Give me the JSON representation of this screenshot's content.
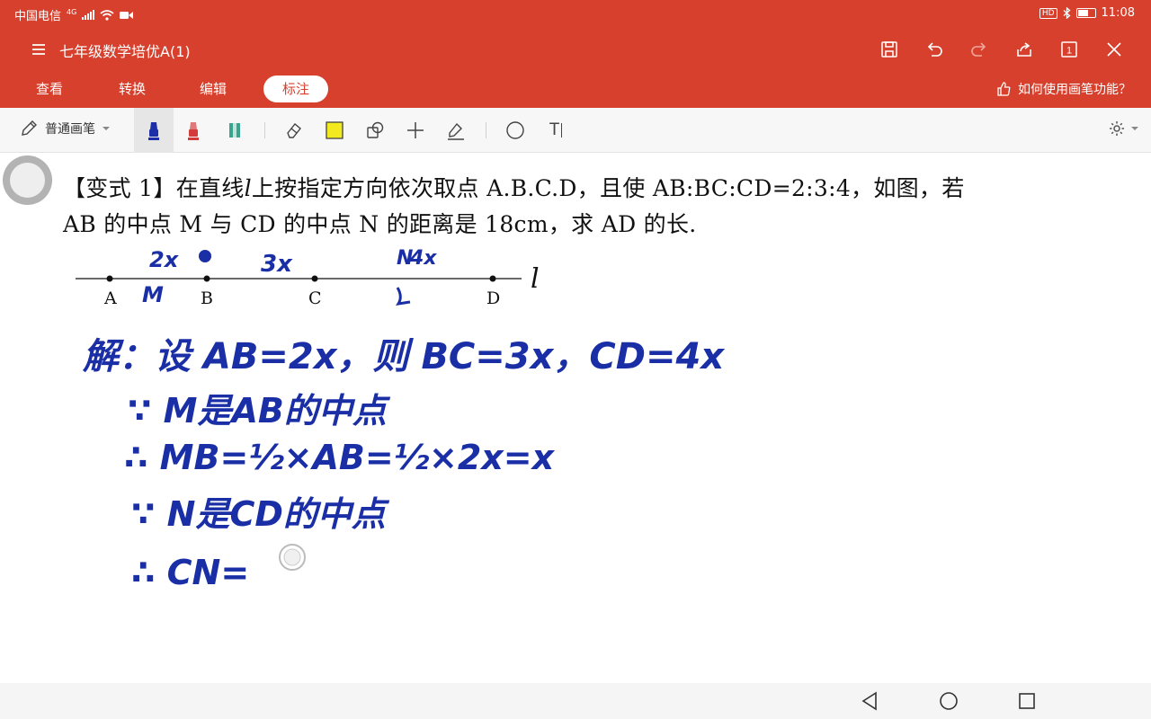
{
  "status": {
    "carrier": "中国电信",
    "network": "4G",
    "time": "11:08",
    "hd_badge": "HD",
    "battery_fraction": 0.55
  },
  "titlebar": {
    "title": "七年级数学培优A(1)",
    "icons": [
      "save-icon",
      "undo-icon",
      "redo-icon",
      "share-icon",
      "page-count-icon",
      "close-icon"
    ],
    "page_count": "1"
  },
  "tabs": {
    "items": [
      {
        "label": "查看",
        "active": false
      },
      {
        "label": "转换",
        "active": false
      },
      {
        "label": "编辑",
        "active": false
      },
      {
        "label": "标注",
        "active": true
      }
    ],
    "help": "如何使用画笔功能？"
  },
  "pen_toolbar": {
    "pen_type": "普通画笔",
    "pen_colors": [
      "#1c2fa8",
      "#d43c3c",
      "#3aa38e"
    ],
    "highlight_color": "#f2ea1f",
    "tools": [
      "eraser-icon",
      "highlight-rect-icon",
      "shapes-icon",
      "plus-icon",
      "signature-icon",
      "circle-icon",
      "text-icon"
    ],
    "text_tool_label": "T"
  },
  "problem": {
    "line1_prefix": "【变式 1】在直线",
    "line_var": "l",
    "line1_suffix": "上按指定方向依次取点 A.B.C.D，且使 AB:BC:CD=2:3:4，如图，若",
    "line2": "AB 的中点 M 与 CD 的中点 N 的距离是 18cm，求 AD 的长."
  },
  "figure": {
    "points": [
      "A",
      "B",
      "C",
      "D"
    ],
    "line_label": "l"
  },
  "handwriting": {
    "ink_color": "#1a2ea6",
    "line1": "解：设 AB=2x，则 BC=3x，CD=4x",
    "line2": "∵ M是AB的中点",
    "line3": "∴ MB=½×AB=½×2x=x",
    "line4": "∵ N是CD的中点",
    "line5": "∴ CN=",
    "fig_ann_ab": "2x",
    "fig_ann_bc": "3x",
    "fig_ann_cd": "4x",
    "fig_ann_m": "M",
    "fig_ann_n": "N"
  }
}
